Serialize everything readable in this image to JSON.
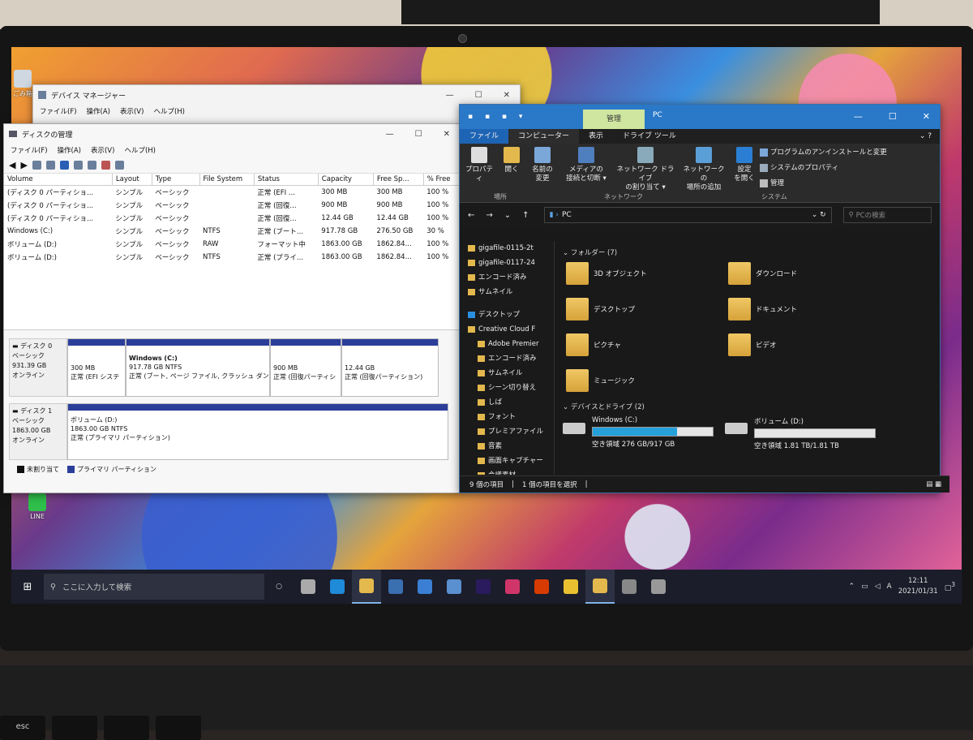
{
  "desktop": {
    "icons": [
      {
        "label": "ごみ箱",
        "icon": "recycle-bin-icon"
      },
      {
        "label": "LINE",
        "icon": "line-app-icon"
      }
    ]
  },
  "device_manager": {
    "title": "デバイス マネージャー",
    "menu": [
      "ファイル(F)",
      "操作(A)",
      "表示(V)",
      "ヘルプ(H)"
    ]
  },
  "disk_management": {
    "title": "ディスクの管理",
    "menu": [
      "ファイル(F)",
      "操作(A)",
      "表示(V)",
      "ヘルプ(H)"
    ],
    "columns": [
      "Volume",
      "Layout",
      "Type",
      "File System",
      "Status",
      "Capacity",
      "Free Sp...",
      "% Free"
    ],
    "rows": [
      [
        "(ディスク 0 パーティショ...",
        "シンプル",
        "ベーシック",
        "",
        "正常 (EFI ...",
        "300 MB",
        "300 MB",
        "100 %"
      ],
      [
        "(ディスク 0 パーティショ...",
        "シンプル",
        "ベーシック",
        "",
        "正常 (回復...",
        "900 MB",
        "900 MB",
        "100 %"
      ],
      [
        "(ディスク 0 パーティショ...",
        "シンプル",
        "ベーシック",
        "",
        "正常 (回復...",
        "12.44 GB",
        "12.44 GB",
        "100 %"
      ],
      [
        "Windows (C:)",
        "シンプル",
        "ベーシック",
        "NTFS",
        "正常 (ブート...",
        "917.78 GB",
        "276.50 GB",
        "30 %"
      ],
      [
        "ボリューム (D:)",
        "シンプル",
        "ベーシック",
        "RAW",
        "フォーマット中",
        "1863.00 GB",
        "1862.84...",
        "100 %"
      ],
      [
        "ボリューム (D:)",
        "シンプル",
        "ベーシック",
        "NTFS",
        "正常 (プライ...",
        "1863.00 GB",
        "1862.84...",
        "100 %"
      ]
    ],
    "disk0": {
      "label": "ディスク 0",
      "type": "ベーシック",
      "size": "931.39 GB",
      "status": "オンライン",
      "partitions": [
        {
          "name": "",
          "size": "300 MB",
          "status": "正常 (EFI システ"
        },
        {
          "name": "Windows (C:)",
          "size": "917.78 GB NTFS",
          "status": "正常 (ブート, ページ ファイル, クラッシュ ダンプ, プ"
        },
        {
          "name": "",
          "size": "900 MB",
          "status": "正常 (回復パーティシ"
        },
        {
          "name": "",
          "size": "12.44 GB",
          "status": "正常 (回復パーティション)"
        }
      ]
    },
    "disk1": {
      "label": "ディスク 1",
      "type": "ベーシック",
      "size": "1863.00 GB",
      "status": "オンライン",
      "partition": {
        "name": "ボリューム (D:)",
        "size": "1863.00 GB NTFS",
        "status": "正常 (プライマリ パーティション)"
      }
    },
    "legend": [
      {
        "label": "未割り当て",
        "color": "#111111"
      },
      {
        "label": "プライマリ パーティション",
        "color": "#2a3e9a"
      }
    ]
  },
  "explorer": {
    "context_tab": "管理",
    "title": "PC",
    "tabs": [
      "ファイル",
      "コンピューター",
      "表示",
      "ドライブ ツール"
    ],
    "ribbon": {
      "location": {
        "label": "場所",
        "buttons": [
          "プロパティ",
          "開く",
          "名前の\n変更"
        ]
      },
      "network": {
        "label": "ネットワーク",
        "buttons": [
          "メディアの\n接続と切断 ▾",
          "ネットワーク ドライブ\nの割り当て ▾",
          "ネットワークの\n場所の追加"
        ]
      },
      "system": {
        "label": "システム",
        "settings": "設定\nを開く",
        "links": [
          "プログラムのアンインストールと変更",
          "システムのプロパティ",
          "管理"
        ]
      }
    },
    "address": "PC",
    "search_placeholder": "PCの検索",
    "nav": [
      "gigafile-0115-2t",
      "gigafile-0117-24",
      "エンコード済み",
      "サムネイル",
      "",
      "デスクトップ",
      "Creative Cloud F",
      "Adobe Premier",
      "エンコード済み",
      "サムネイル",
      "シーン切り替え",
      "しば",
      "フォント",
      "プレミアファイル",
      "音素",
      "画面キャプチャー",
      "会議素材"
    ],
    "folders_header": "フォルダー (7)",
    "folders": [
      "3D オブジェクト",
      "ダウンロード",
      "デスクトップ",
      "ドキュメント",
      "ピクチャ",
      "ビデオ",
      "ミュージック"
    ],
    "drives_header": "デバイスとドライブ (2)",
    "drives": [
      {
        "name": "Windows (C:)",
        "free": "空き領域 276 GB/917 GB",
        "used_fraction": 0.7
      },
      {
        "name": "ボリューム (D:)",
        "free": "空き領域 1.81 TB/1.81 TB",
        "used_fraction": 0.0
      }
    ],
    "status": [
      "9 個の項目",
      "1 個の項目を選択"
    ]
  },
  "taskbar": {
    "search_placeholder": "ここに入力して検索",
    "apps": [
      "task-view-icon",
      "edge-icon",
      "file-explorer-icon",
      "store-icon",
      "mail-icon",
      "photos-icon",
      "premiere-icon",
      "creative-cloud-icon",
      "office-icon",
      "chrome-icon",
      "explorer-window-icon",
      "disk-mgmt-icon",
      "device-mgr-icon"
    ],
    "ime": "A",
    "time": "12:11",
    "date": "2021/01/31",
    "notifications": "3"
  },
  "keyboard": {
    "esc": "esc"
  }
}
